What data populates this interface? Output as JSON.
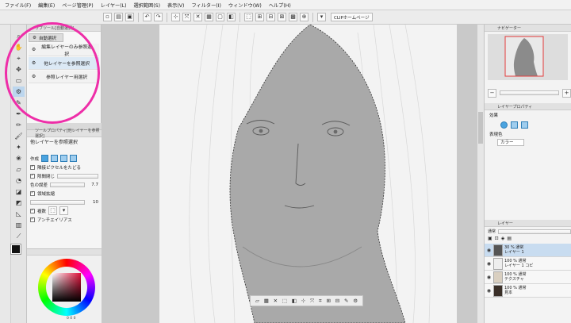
{
  "menubar": {
    "items": [
      "ファイル(F)",
      "編集(E)",
      "ページ管理(P)",
      "レイヤー(L)",
      "選択範囲(S)",
      "表示(V)",
      "フィルター(I)",
      "ウィンドウ(W)",
      "ヘルプ(H)"
    ]
  },
  "commandbar": {
    "icons": [
      "save-icon",
      "undo-icon",
      "redo-icon",
      "transform-icon",
      "clear-icon",
      "fill-icon",
      "selection-icon",
      "grid-icon"
    ],
    "doc_tab": "CLIPホームページ"
  },
  "subtool": {
    "title": "サブツール[自動選択]",
    "tab_label": "自動選択",
    "items": [
      {
        "label": "編集レイヤーのみ参照選択",
        "icon": "wand-icon"
      },
      {
        "label": "他レイヤーを参照選択",
        "icon": "wand-icon"
      },
      {
        "label": "参照レイヤー用選択",
        "icon": "wand-icon"
      }
    ]
  },
  "toolprop": {
    "title": "ツールプロパティ[他レイヤーを参照選択]",
    "heading": "他レイヤーを参照選択",
    "mode_label": "作成",
    "opt_follow": "隣接ピクセルをたどる",
    "opt_gap": "隙間閉じ",
    "opt_tolerance": "色の誤差",
    "tolerance_value": "7.7",
    "opt_expand": "領域拡縮",
    "expand_value": "10",
    "opt_refer": "複数",
    "opt_aa": "アンチエイリアス"
  },
  "colorpanel": {
    "readout": "0 0 0"
  },
  "navigator": {
    "title": "ナビゲーター"
  },
  "layerprop": {
    "title": "レイヤープロパティ",
    "effect_label": "効果",
    "color_label": "表現色",
    "color_value": "カラー"
  },
  "layers": {
    "title": "レイヤー",
    "blend": "通常",
    "rows": [
      {
        "opacity": "30 %",
        "mode": "通常",
        "name": "レイヤー 1"
      },
      {
        "opacity": "100 %",
        "mode": "通常",
        "name": "レイヤー 1 コピ"
      },
      {
        "opacity": "100 %",
        "mode": "通常",
        "name": "テクスチャ"
      },
      {
        "opacity": "100 %",
        "mode": "通常",
        "name": "見本"
      }
    ]
  },
  "colors": {
    "annotation": "#ee2ea8",
    "selected_row": "#c8dcf0"
  }
}
